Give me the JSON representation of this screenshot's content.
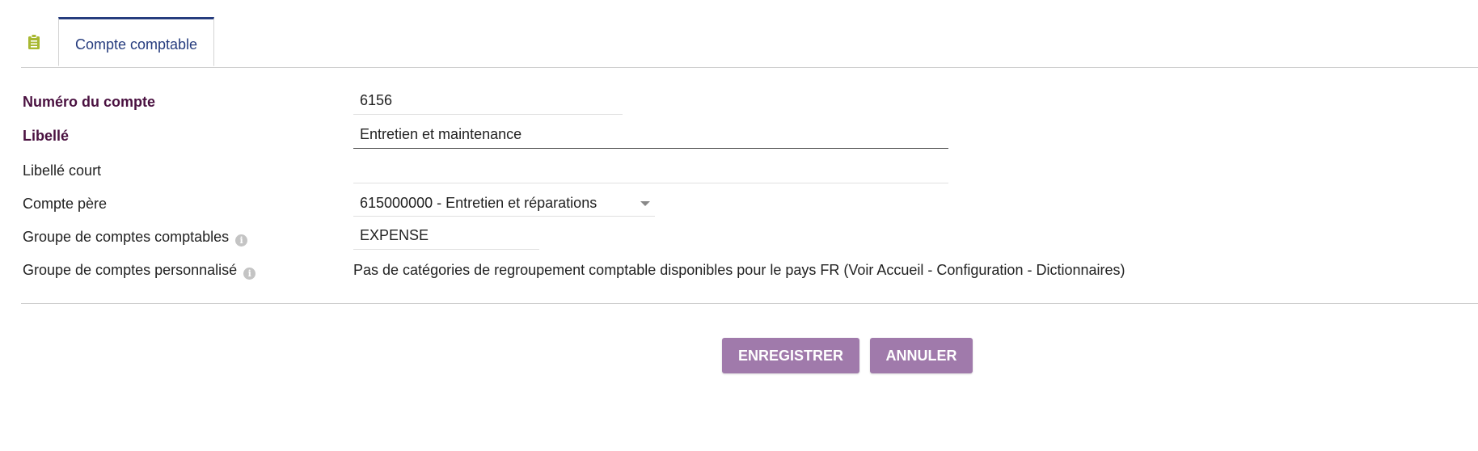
{
  "tab": {
    "icon": "clipboard-icon",
    "label": "Compte comptable"
  },
  "form": {
    "account_number": {
      "label": "Numéro du compte",
      "value": "6156"
    },
    "label": {
      "label": "Libellé",
      "value": "Entretien et maintenance"
    },
    "short_label": {
      "label": "Libellé court",
      "value": ""
    },
    "parent_account": {
      "label": "Compte père",
      "value": "615000000 - Entretien et réparations"
    },
    "account_group": {
      "label": "Groupe de comptes comptables",
      "value": "EXPENSE"
    },
    "custom_group": {
      "label": "Groupe de comptes personnalisé",
      "text": "Pas de catégories de regroupement comptable disponibles pour le pays FR (Voir Accueil - Configuration - Dictionnaires)"
    }
  },
  "buttons": {
    "save": "ENREGISTRER",
    "cancel": "ANNULER"
  },
  "colors": {
    "accent": "#263c7e",
    "button": "#a07aab",
    "required_label": "#4a1140",
    "tab_icon": "#a8b832"
  }
}
